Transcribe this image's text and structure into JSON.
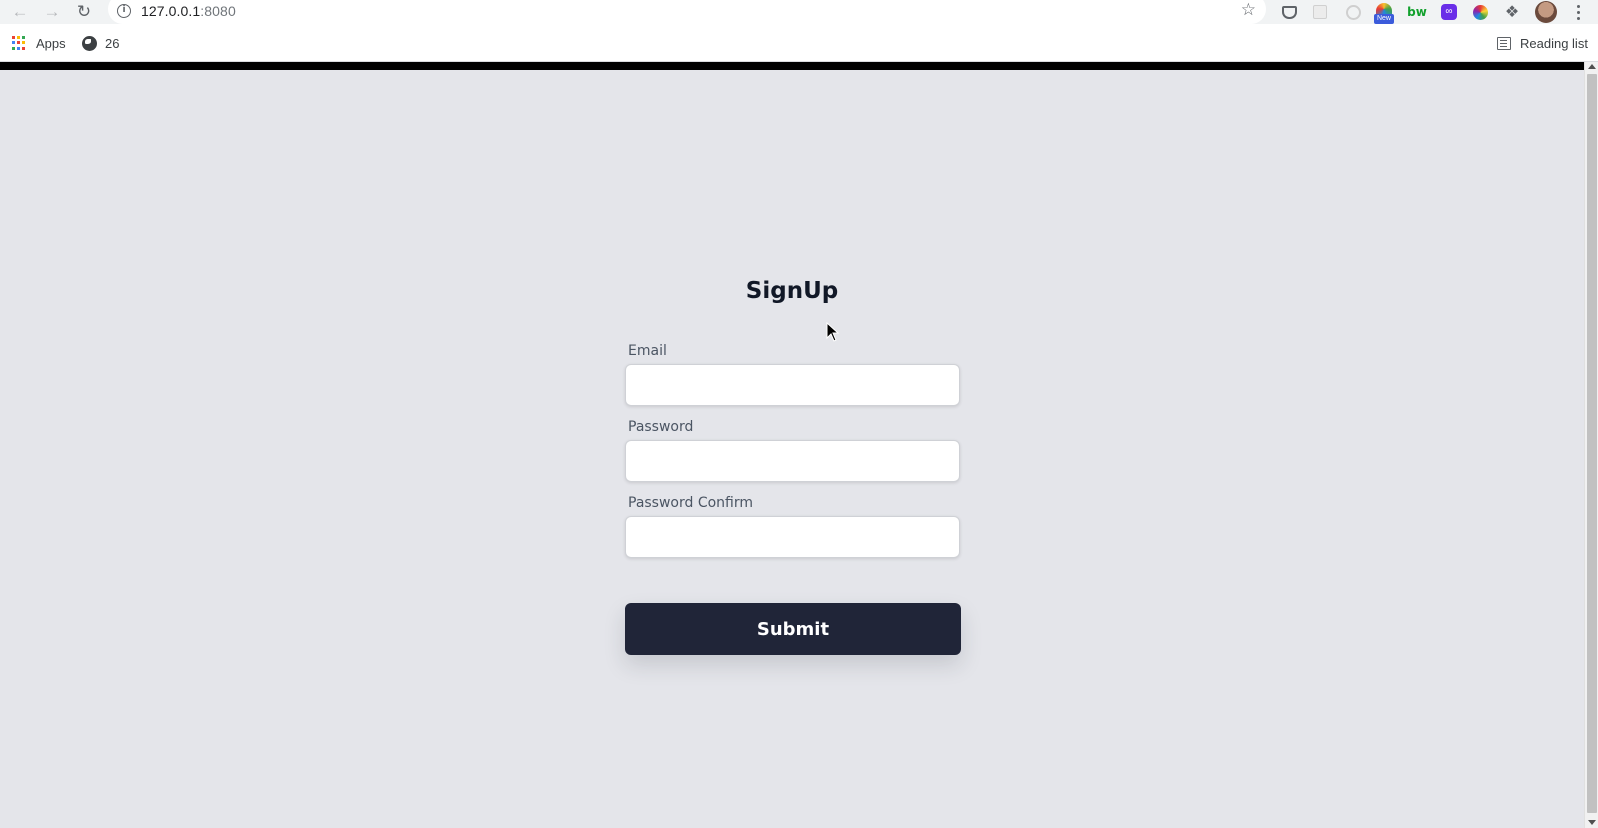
{
  "browser": {
    "url_host": "127.0.0.1",
    "url_port": ":8080",
    "bookmarks": [
      {
        "label": "Apps",
        "icon": "apps-grid-icon"
      },
      {
        "label": "26",
        "icon": "globe-icon"
      }
    ],
    "reading_list_label": "Reading list",
    "extension_badge": "New",
    "extension_bw_label": "bw"
  },
  "page": {
    "title": "SignUp",
    "fields": [
      {
        "label": "Email",
        "value": "",
        "placeholder": ""
      },
      {
        "label": "Password",
        "value": "",
        "placeholder": ""
      },
      {
        "label": "Password Confirm",
        "value": "",
        "placeholder": ""
      }
    ],
    "submit_label": "Submit"
  },
  "colors": {
    "page_background": "#e4e5ea",
    "button_background": "#202538",
    "button_text": "#ffffff",
    "title_text": "#111827",
    "label_text": "#4b5563"
  }
}
